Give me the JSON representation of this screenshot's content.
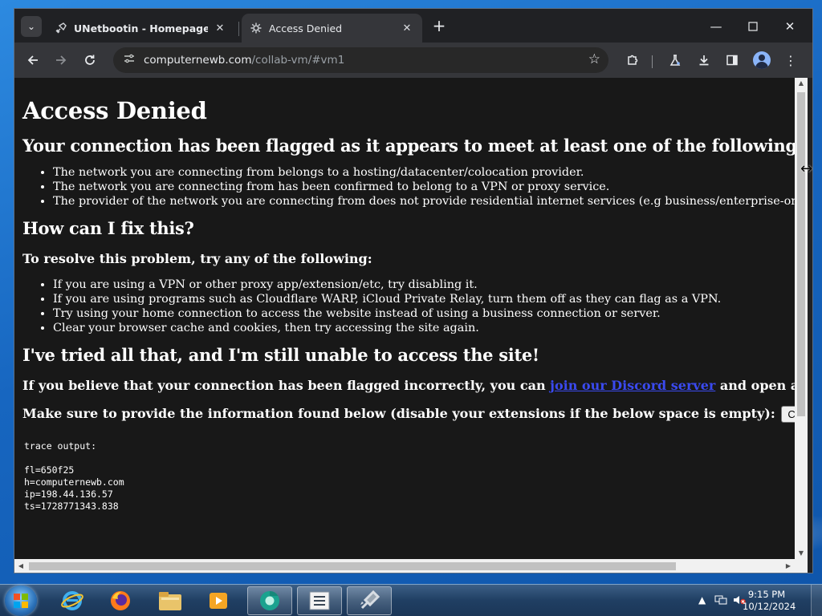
{
  "browser": {
    "tabs": [
      {
        "title": "UNetbootin - Homepage and Do",
        "favicon": "rocket-icon",
        "active": false
      },
      {
        "title": "Access Denied",
        "favicon": "gear-icon",
        "active": true
      }
    ],
    "url_host": "computernewb.com",
    "url_path": "/collab-vm/#vm1"
  },
  "page": {
    "title": "Access Denied",
    "criteria_heading": "Your connection has been flagged as it appears to meet at least one of the following criteria:",
    "criteria": [
      "The network you are connecting from belongs to a hosting/datacenter/colocation provider.",
      "The network you are connecting from has been confirmed to belong to a VPN or proxy service.",
      "The provider of the network you are connecting from does not provide residential internet services (e.g business/enterprise-only networks)."
    ],
    "fix_heading": "How can I fix this?",
    "resolve_subheading": "To resolve this problem, try any of the following:",
    "fixes": [
      "If you are using a VPN or other proxy app/extension/etc, try disabling it.",
      "If you are using programs such as Cloudflare WARP, iCloud Private Relay, turn them off as they can flag as a VPN.",
      "Try using your home connection to access the website instead of using a business connection or server.",
      "Clear your browser cache and cookies, then try accessing the site again."
    ],
    "tried_heading": "I've tried all that, and I'm still unable to access the site!",
    "incorrect_prefix": "If you believe that your connection has been flagged incorrectly, you can ",
    "discord_link": "join our Discord server",
    "incorrect_suffix": " and open a ticket.",
    "provide_info": "Make sure to provide the information found below (disable your extensions if the below space is empty):",
    "copy_button": "Copy to clipboard",
    "trace_label": "trace output:",
    "trace_lines": [
      "fl=650f25",
      "h=computernewb.com",
      "ip=198.44.136.57",
      "ts=1728771343.838"
    ]
  },
  "taskbar": {
    "time": "9:15 PM",
    "date": "10/12/2024"
  }
}
